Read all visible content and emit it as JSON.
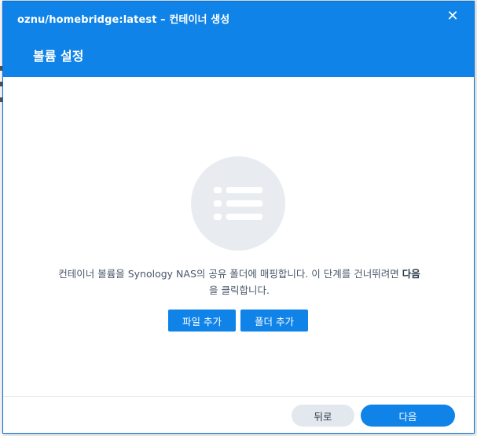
{
  "dialog": {
    "title": "oznu/homebridge:latest – 컨테이너 생성",
    "close_icon": "close-icon",
    "header_title": "볼륨 설정"
  },
  "empty_state": {
    "icon": "list-icon",
    "description_part1": "컨테이너 볼륨을 Synology NAS의 공유 폴더에 매핑합니다. 이 단계를 건너뛰려면 ",
    "description_bold": "다음",
    "description_part2": "을 클릭합니다."
  },
  "actions": {
    "add_file_label": "파일 추가",
    "add_folder_label": "폴더 추가"
  },
  "footer": {
    "back_label": "뒤로",
    "next_label": "다음"
  },
  "colors": {
    "accent": "#0f83e8",
    "secondary_button": "#e3e8ee",
    "icon_circle": "#e8ecf1"
  }
}
